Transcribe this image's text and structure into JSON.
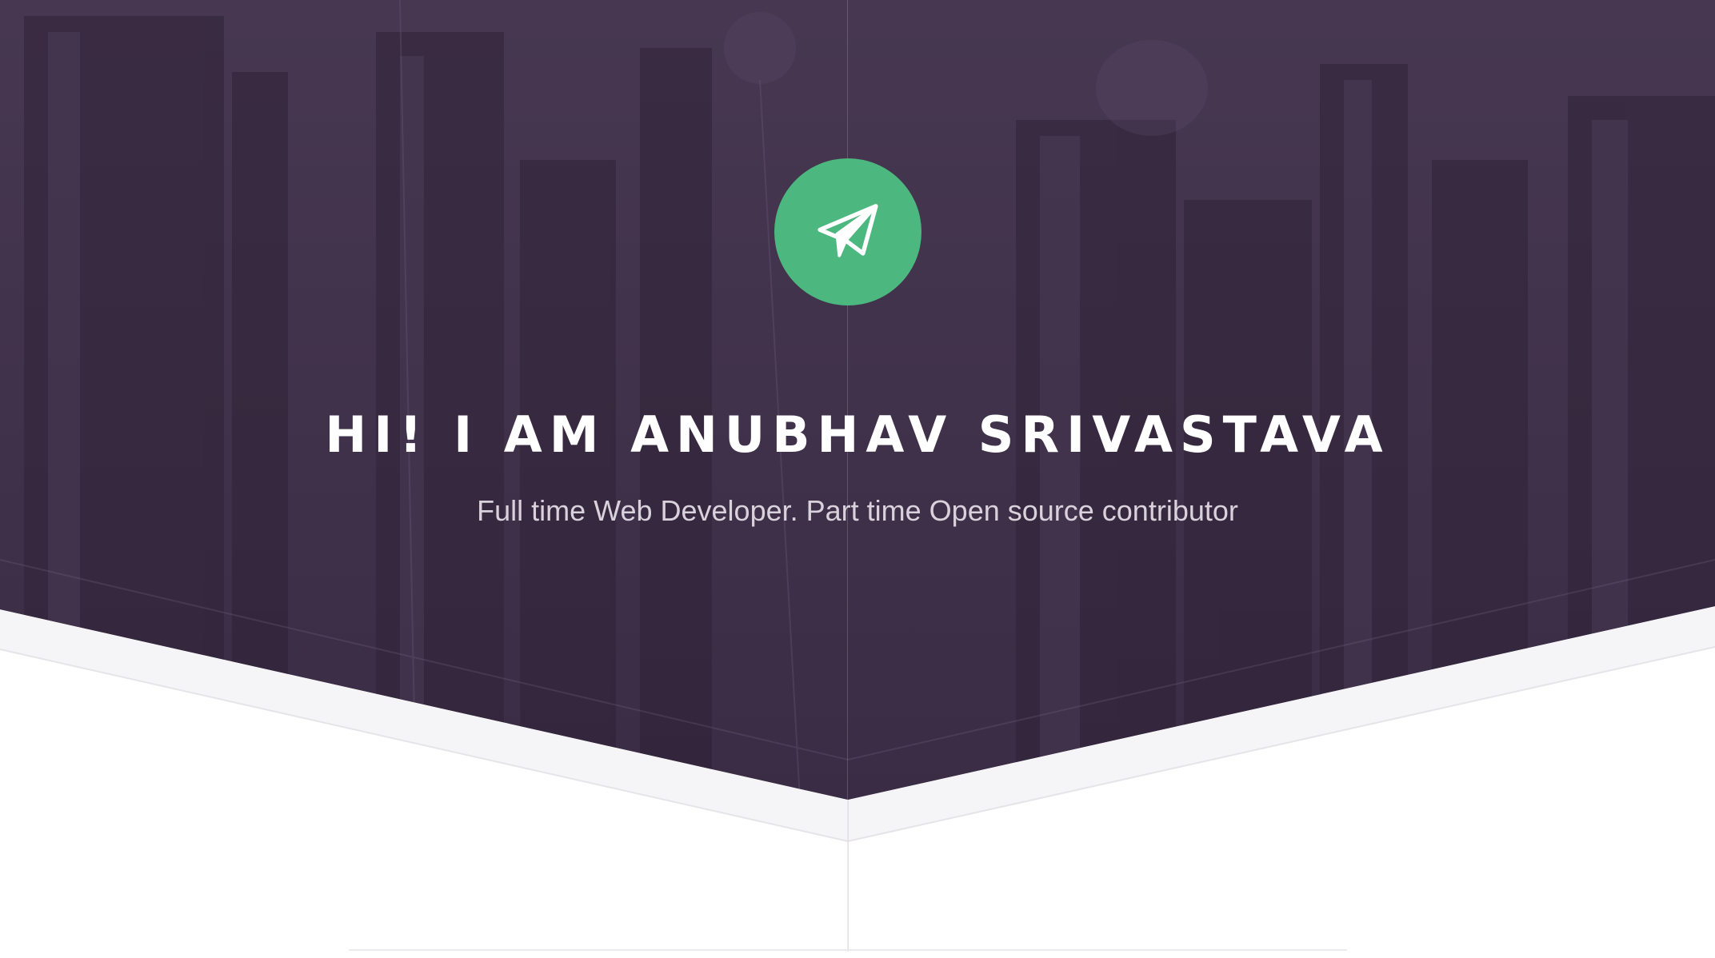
{
  "hero": {
    "logo_icon": "paper-plane-icon",
    "logo_color": "#4cb880",
    "title": "HI! I AM ANUBHAV SRIVASTAVA",
    "subtitle": "Full time Web Developer. Part time Open source contributor"
  },
  "colors": {
    "hero_overlay": "#3f3047",
    "title_text": "#ffffff",
    "subtitle_text": "#d9d2dc"
  }
}
